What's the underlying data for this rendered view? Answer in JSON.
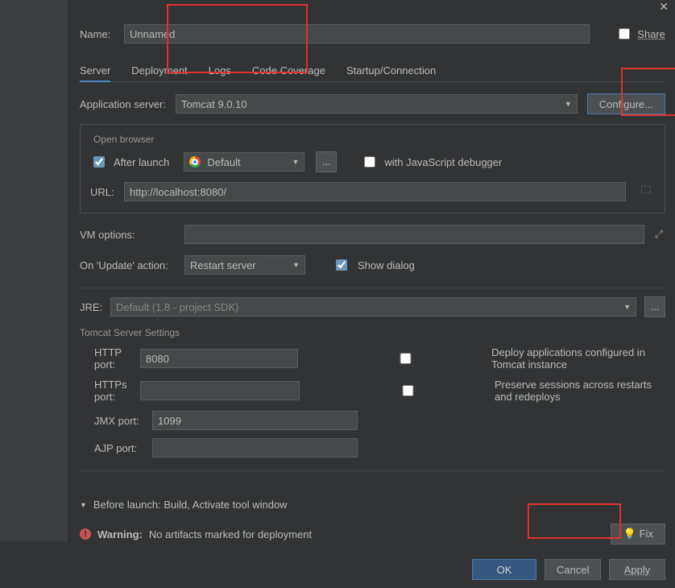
{
  "header": {
    "name_label": "Name:",
    "name_value": "Unnamed",
    "share_label": "Share"
  },
  "tabs": {
    "server": "Server",
    "deployment": "Deployment",
    "logs": "Logs",
    "code_coverage": "Code Coverage",
    "startup": "Startup/Connection"
  },
  "app": {
    "label": "Application server:",
    "value": "Tomcat 9.0.10",
    "configure": "Configure..."
  },
  "open_browser": {
    "legend": "Open browser",
    "after_launch": "After launch",
    "browser_value": "Default",
    "browse_btn": "...",
    "js_debug": "with JavaScript debugger",
    "url_label": "URL:",
    "url_value": "http://localhost:8080/"
  },
  "vm": {
    "label": "VM options:",
    "value": ""
  },
  "update": {
    "label": "On 'Update' action:",
    "value": "Restart server",
    "show_dialog": "Show dialog"
  },
  "jre": {
    "label": "JRE:",
    "value": "Default (1.8 - project SDK)",
    "browse": "..."
  },
  "tomcat": {
    "legend": "Tomcat Server Settings",
    "http_label": "HTTP port:",
    "http_value": "8080",
    "https_label": "HTTPs port:",
    "https_value": "",
    "jmx_label": "JMX port:",
    "jmx_value": "1099",
    "ajp_label": "AJP port:",
    "ajp_value": "",
    "deploy_cb": "Deploy applications configured in Tomcat instance",
    "preserve_cb": "Preserve sessions across restarts and redeploys"
  },
  "before": {
    "label": "Before launch: Build, Activate tool window"
  },
  "warning": {
    "label": "Warning:",
    "text": "No artifacts marked for deployment",
    "fix": "Fix"
  },
  "footer": {
    "ok": "OK",
    "cancel": "Cancel",
    "apply": "Apply"
  }
}
